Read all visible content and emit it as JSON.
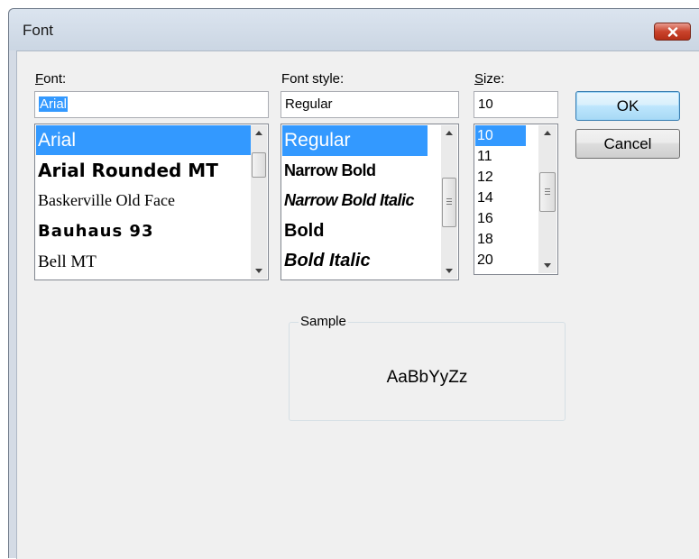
{
  "window": {
    "title": "Font"
  },
  "font": {
    "label": "Font:",
    "value": "Arial",
    "items": [
      "Arial",
      "Arial Rounded MT",
      "Baskerville Old Face",
      "Bauhaus 93",
      "Bell MT"
    ]
  },
  "font_style": {
    "label": "Font style:",
    "value": "Regular",
    "items": [
      "Regular",
      "Narrow Bold",
      "Narrow Bold Italic",
      "Bold",
      "Bold Italic"
    ]
  },
  "size": {
    "label": "Size:",
    "value": "10",
    "items": [
      "10",
      "11",
      "12",
      "14",
      "16",
      "18",
      "20"
    ]
  },
  "buttons": {
    "ok": "OK",
    "cancel": "Cancel"
  },
  "sample": {
    "label": "Sample",
    "text": "AaBbYyZz"
  },
  "colors": {
    "selection": "#3399ff",
    "close_button": "#c9432c",
    "default_button_border": "#3c7fb1"
  }
}
